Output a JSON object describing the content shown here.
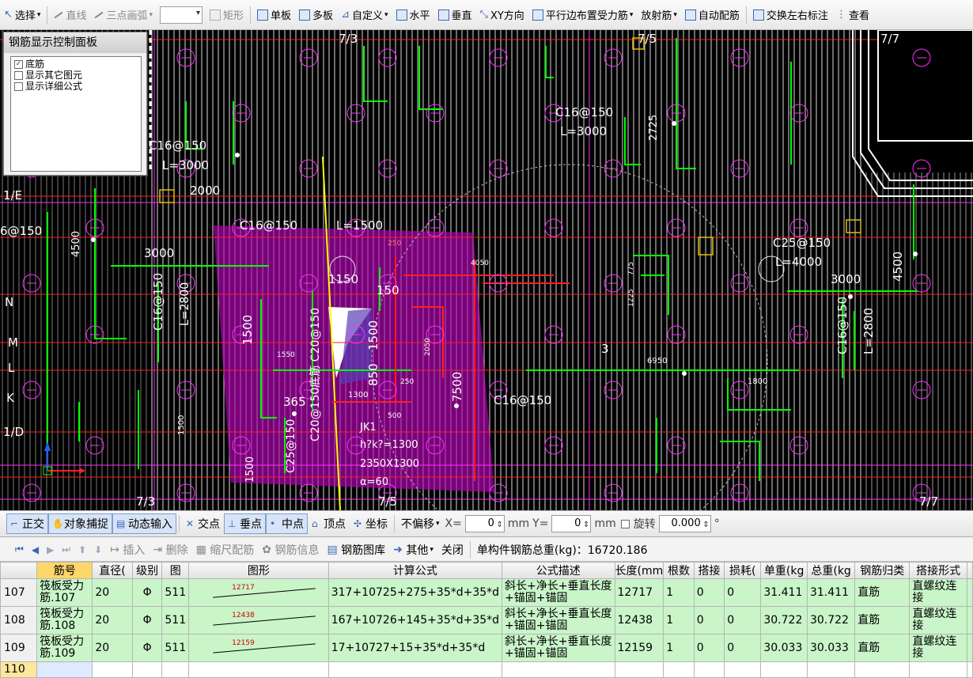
{
  "toolbar": {
    "select": "选择",
    "line": "直线",
    "arc": "三点画弧",
    "rect": "矩形",
    "single_slab": "单板",
    "multi_slab": "多板",
    "custom": "自定义",
    "horizontal": "水平",
    "vertical": "垂直",
    "xy": "XY方向",
    "parallel": "平行边布置受力筋",
    "radial": "放射筋",
    "auto": "自动配筋",
    "swap": "交换左右标注",
    "view": "查看"
  },
  "control_panel": {
    "title": "钢筋显示控制面板",
    "items": [
      {
        "label": "底筋",
        "checked": true
      },
      {
        "label": "显示其它图元",
        "checked": false
      },
      {
        "label": "显示详细公式",
        "checked": false
      }
    ]
  },
  "drawing": {
    "grid_labels": [
      "7/3",
      "7/5",
      "7/7",
      "7/3",
      "7/5",
      "7/7",
      "1/E",
      "N",
      "M",
      "L",
      "K",
      "1/D"
    ],
    "rebar_labels": [
      "C16@150",
      "L=3000",
      "2000",
      "C16@150",
      "L=1500",
      "C16@150",
      "L=3000",
      "2725",
      "C25@150",
      "L=4000",
      "3000",
      "4500",
      "C16@150",
      "L=2800",
      "3000",
      "4500",
      "C16@150",
      "L=2800",
      "6@150",
      "C16@150",
      "7500",
      "C20@150底筋 C20@150",
      "C25@150",
      "1500",
      "3",
      "6950",
      "1800",
      "1500"
    ],
    "dims": [
      "1150",
      "150",
      "1500",
      "1500",
      "850",
      "365",
      "250",
      "2050",
      "4050",
      "1300",
      "500",
      "250",
      "1550",
      "1225",
      "775"
    ],
    "pit_text": [
      "JK1",
      "h?k?=1300",
      "2350X1300",
      "α=60"
    ]
  },
  "snapbar": {
    "ortho": "正交",
    "snap": "对象捕捉",
    "dynamic": "动态输入",
    "intersect": "交点",
    "perp": "垂点",
    "mid": "中点",
    "vertex": "顶点",
    "coord": "坐标",
    "offset_mode": "不偏移",
    "x_label": "X=",
    "x_value": "0",
    "mm1": "mm",
    "y_label": "Y=",
    "y_value": "0",
    "mm2": "mm",
    "rotate": "旋转",
    "rotate_value": "0.000",
    "degree": "°"
  },
  "gridbar": {
    "insert": "插入",
    "delete": "删除",
    "scale": "缩尺配筋",
    "info": "钢筋信息",
    "library": "钢筋图库",
    "other": "其他",
    "close": "关闭",
    "total": "单构件钢筋总重(kg)：16720.186"
  },
  "table": {
    "headers": [
      "",
      "筋号",
      "直径(",
      "级别",
      "图",
      "图形",
      "计算公式",
      "公式描述",
      "长度(mm",
      "根数",
      "搭接",
      "损耗(",
      "单重(kg",
      "总重(kg",
      "钢筋归类",
      "搭接形式",
      ""
    ],
    "rows": [
      {
        "no": "107",
        "name": "筏板受力筋.107",
        "dia": "20",
        "grade": "Φ",
        "fig": "511",
        "shape_len": "12717",
        "formula": "317+10725+275+35*d+35*d",
        "desc": "斜长+净长+垂直长度+锚固+锚固",
        "length": "12717",
        "count": "1",
        "lap": "0",
        "loss": "0",
        "unit_wt": "31.411",
        "total_wt": "31.411",
        "type": "直筋",
        "lap_type": "直螺纹连接"
      },
      {
        "no": "108",
        "name": "筏板受力筋.108",
        "dia": "20",
        "grade": "Φ",
        "fig": "511",
        "shape_len": "12438",
        "formula": "167+10726+145+35*d+35*d",
        "desc": "斜长+净长+垂直长度+锚固+锚固",
        "length": "12438",
        "count": "1",
        "lap": "0",
        "loss": "0",
        "unit_wt": "30.722",
        "total_wt": "30.722",
        "type": "直筋",
        "lap_type": "直螺纹连接"
      },
      {
        "no": "109",
        "name": "筏板受力筋.109",
        "dia": "20",
        "grade": "Φ",
        "fig": "511",
        "shape_len": "12159",
        "formula": "17+10727+15+35*d+35*d",
        "desc": "斜长+净长+垂直长度+锚固+锚固",
        "length": "12159",
        "count": "1",
        "lap": "0",
        "loss": "0",
        "unit_wt": "30.033",
        "total_wt": "30.033",
        "type": "直筋",
        "lap_type": "直螺纹连接"
      }
    ],
    "new_row": "110"
  },
  "colors": {
    "slab": "#8b008b",
    "rebar_green": "#00ff00",
    "grid_red": "#ff0000",
    "row_green": "#c9f5c9"
  }
}
